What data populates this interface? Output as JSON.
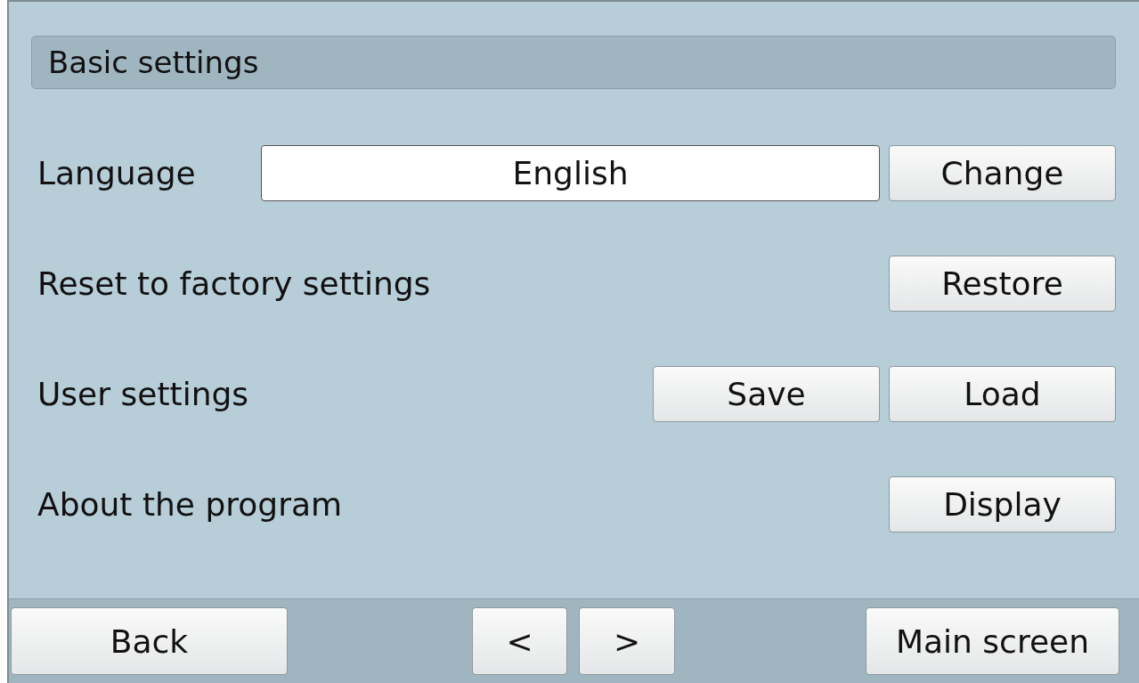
{
  "title": "Basic settings",
  "rows": [
    {
      "label": "Language",
      "field": {
        "value": "English"
      },
      "buttons": [
        "Change"
      ]
    },
    {
      "label": "Reset to factory settings",
      "buttons": [
        "Restore"
      ]
    },
    {
      "label": "User settings",
      "buttons": [
        "Save",
        "Load"
      ]
    },
    {
      "label": "About the program",
      "buttons": [
        "Display"
      ]
    }
  ],
  "footer": {
    "back": "Back",
    "prev": "<",
    "next": ">",
    "main": "Main screen"
  }
}
